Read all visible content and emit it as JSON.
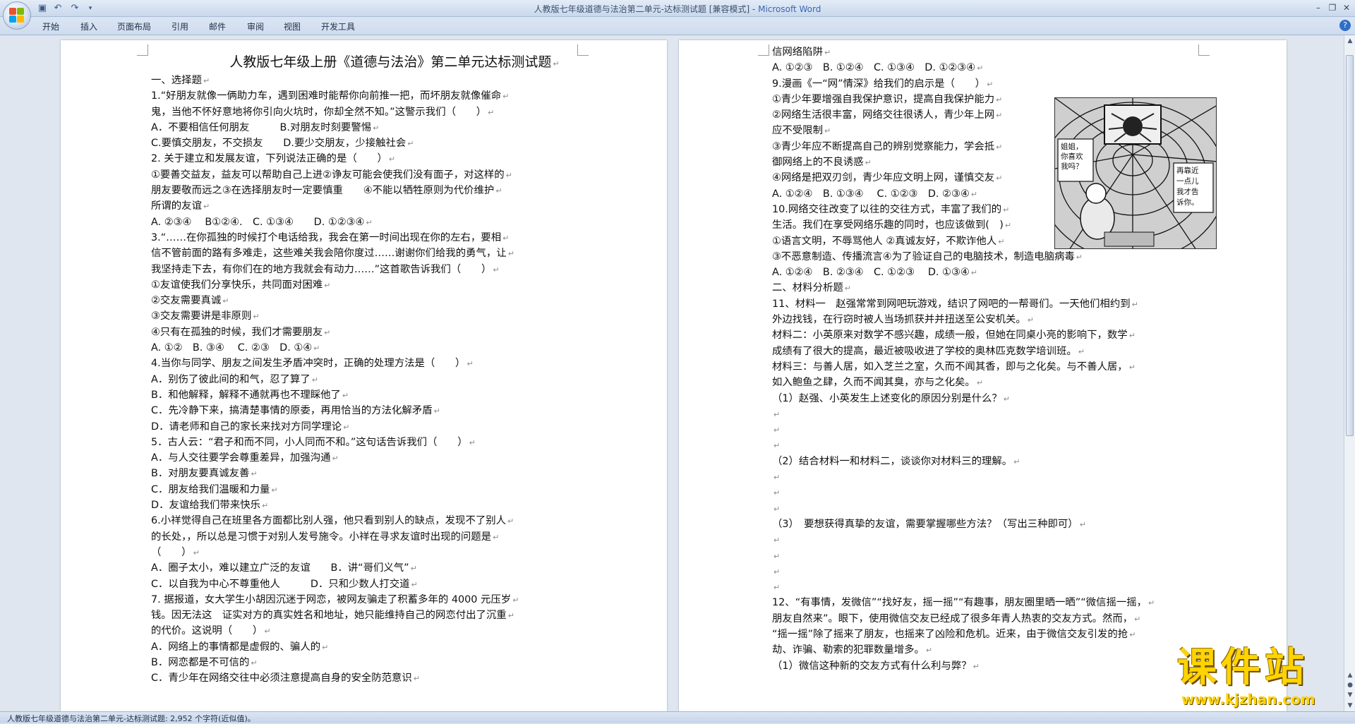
{
  "window": {
    "title": "人教版七年级道德与法治第二单元-达标测试题 [兼容模式] - ",
    "app_name": "Microsoft Word"
  },
  "ribbon": {
    "tabs": [
      "开始",
      "插入",
      "页面布局",
      "引用",
      "邮件",
      "审阅",
      "视图",
      "开发工具"
    ]
  },
  "left_page": {
    "lines": [
      "人教版七年级上册《道德与法治》第二单元达标测试题",
      "一、选择题",
      "1.“好朋友就像一俩助力车，遇到困难时能帮你向前推一把，而坏朋友就像催命",
      "鬼，当他不怀好意地将你引向火坑时，你却全然不知。”这警示我们（　　）",
      "A．不要相信任何朋友　　　B.对朋友时刻要警惕",
      "C.要慎交朋友，不交损友　　D.要少交朋友，少接触社会",
      "2. 关于建立和发展友谊，下列说法正确的是（　　）",
      "①要善交益友，益友可以帮助自己上进②诤友可能会使我们没有面子，对这样的",
      "朋友要敬而远之③在选择朋友时一定要慎重　　④不能以牺牲原则为代价维护",
      "所谓的友谊",
      "A. ②③④　 B①②④.　C. ①③④　　D. ①②③④",
      "3.“……在你孤独的时候打个电话给我，我会在第一时间出现在你的左右，要相",
      "信不管前面的路有多难走，这些难关我会陪你度过……谢谢你们给我的勇气，让",
      "我坚持走下去，有你们在的地方我就会有动力……”这首歌告诉我们（　　）",
      "①友谊使我们分享快乐，共同面对困难",
      "②交友需要真诚",
      "③交友需要讲是非原则",
      "④只有在孤独的时候，我们才需要朋友",
      "A. ①②　B. ③④　 C. ②③　D. ①④",
      "4.当你与同学、朋友之间发生矛盾冲突时，正确的处理方法是（　　）",
      "A．别伤了彼此间的和气，忍了算了",
      "B．和他解释，解释不通就再也不理睬他了",
      "C．先冷静下来，搞清楚事情的原委，再用恰当的方法化解矛盾",
      "D．请老师和自己的家长来找对方同学理论",
      "5．古人云：“君子和而不同，小人同而不和。”这句话告诉我们（　　）",
      "A．与人交往要学会尊重差异，加强沟通",
      "B．对朋友要真诚友善",
      "C．朋友给我们温暖和力量",
      "D．友谊给我们带来快乐",
      "6.小祥觉得自己在班里各方面都比别人强，他只看到别人的缺点，发现不了别人",
      "的长处，，所以总是习惯于对别人发号施令。小祥在寻求友谊时出现的问题是",
      "（　　）",
      "A．圈子太小，难以建立广泛的友谊　　B．讲“哥们义气”",
      "C．以自我为中心不尊重他人　　　D．只和少数人打交道",
      "7. 据报道，女大学生小胡因沉迷于网恋，被网友骗走了积蓄多年的 4000 元压岁",
      "钱。因无法这　证实对方的真实姓名和地址，她只能维持自己的网恋付出了沉重",
      "的代价。这说明（　　）",
      "A．网络上的事情都是虚假的、骗人的",
      "B．网恋都是不可信的",
      "C．青少年在网络交往中必须注意提高自身的安全防范意识"
    ]
  },
  "right_page": {
    "lines": [
      "信网络陷阱",
      "A. ①②③　B. ①②④　C. ①③④　D. ①②③④",
      "9.漫画《一“网”情深》给我们的启示是（　　）",
      "①青少年要增强自我保护意识，提高自我保护能力",
      "②网络生活很丰富，网络交往很诱人，青少年上网",
      "应不受限制",
      "③青少年应不断提高自己的辨别觉察能力，学会抵",
      "御网络上的不良诱惑",
      "④网络是把双刃剑，青少年应文明上网，谨慎交友",
      "A. ①②④　B. ①③④　 C. ①②③　D. ②③④",
      "10.网络交往改变了以往的交往方式，丰富了我们的",
      "生活。我们在享受网络乐趣的同时，也应该做到(　)",
      "①语言文明，不辱骂他人 ②真诚友好，不欺诈他人",
      "③不恶意制造、传播流言④为了验证自己的电脑技术，制造电脑病毒",
      "A. ①②④　B. ②③④　C. ①②③　 D. ①③④",
      "二、材料分析题",
      "11、材料一　赵强常常到网吧玩游戏，结识了网吧的一帮哥们。一天他们相约到",
      "外边找钱，在行窃时被人当场抓获并并扭送至公安机关。",
      "材料二：小英原来对数学不感兴趣，成绩一般，但她在同桌小亮的影响下，数学",
      "成绩有了很大的提高，最近被吸收进了学校的奥林匹克数学培训班。",
      "材料三：与善人居，如入芝兰之室，久而不闻其香，即与之化矣。与不善人居，",
      "如入鲍鱼之肆，久而不闻其臭，亦与之化矣。",
      "（1）赵强、小英发生上述变化的原因分别是什么？",
      "",
      "",
      "",
      "（2）结合材料一和材料二，谈谈你对材料三的理解。",
      "",
      "",
      "",
      "（3）　要想获得真挚的友谊，需要掌握哪些方法？（写出三种即可）",
      "",
      "",
      "",
      "",
      "12、“有事情，发微信”“找好友，摇一摇”“有趣事，朋友圈里晒一晒”“微信摇一摇，",
      "朋友自然来”。眼下，使用微信交友已经成了很多年青人热衷的交友方式。然而，",
      "“摇一摇”除了摇来了朋友，也摇来了凶险和危机。近来，由于微信交友引发的抢",
      "劫、诈骗、勒索的犯罪数量增多。",
      "（1）微信这种新的交友方式有什么利与弊？"
    ]
  },
  "cartoon": {
    "speech_left": [
      "姐姐，",
      "你喜欢",
      "我吗？"
    ],
    "speech_right": [
      "再靠近",
      "一点儿",
      "我才告",
      "诉你。"
    ]
  },
  "statusbar": {
    "text": "人教版七年级道德与法治第二单元-达标测试题: 2,952 个字符(近似值)。"
  },
  "watermark": {
    "name": "课件站",
    "url": "www.kjzhan.com"
  }
}
